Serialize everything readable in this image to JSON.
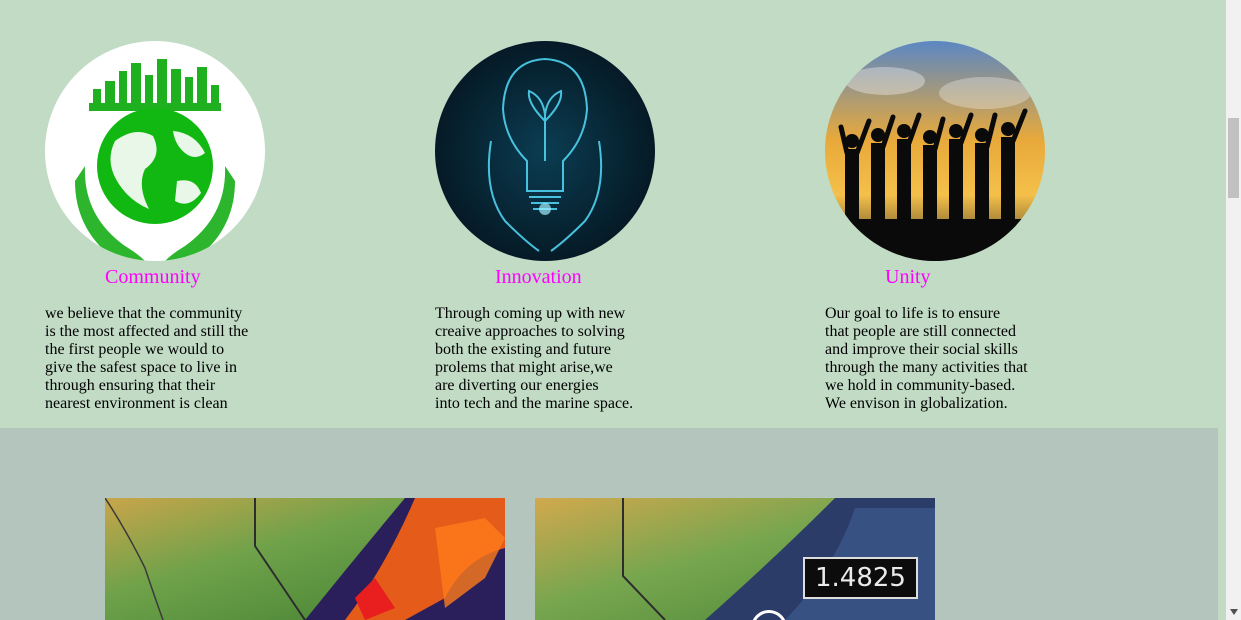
{
  "features": [
    {
      "title": "Community",
      "icon": "globe-in-hands-icon",
      "text": "we believe that the community\nis the most affected and still the\nthe first people we would to\ngive the safest space to live in\nthrough ensuring that their\nnearest environment is clean"
    },
    {
      "title": "Innovation",
      "icon": "lightbulb-plant-icon",
      "text": "Through coming up with new\ncreaive approaches to solving\nboth the existing and future\nprolems that might arise,we\nare diverting our energies\ninto tech and the marine space."
    },
    {
      "title": "Unity",
      "icon": "people-sunset-icon",
      "text": "Our goal to life is to ensure\nthat people are still connected\nand improve their social skills\nthrough the many activities that\nwe hold in community-based.\nWe envison in globalization."
    }
  ],
  "maps": [
    {
      "name": "sst-map-left"
    },
    {
      "name": "sst-map-right",
      "readout": "1.4825"
    }
  ],
  "colors": {
    "top_bg": "#c1dbc5",
    "bottom_bg": "#b3c5bd",
    "title": "#ff00ff"
  }
}
